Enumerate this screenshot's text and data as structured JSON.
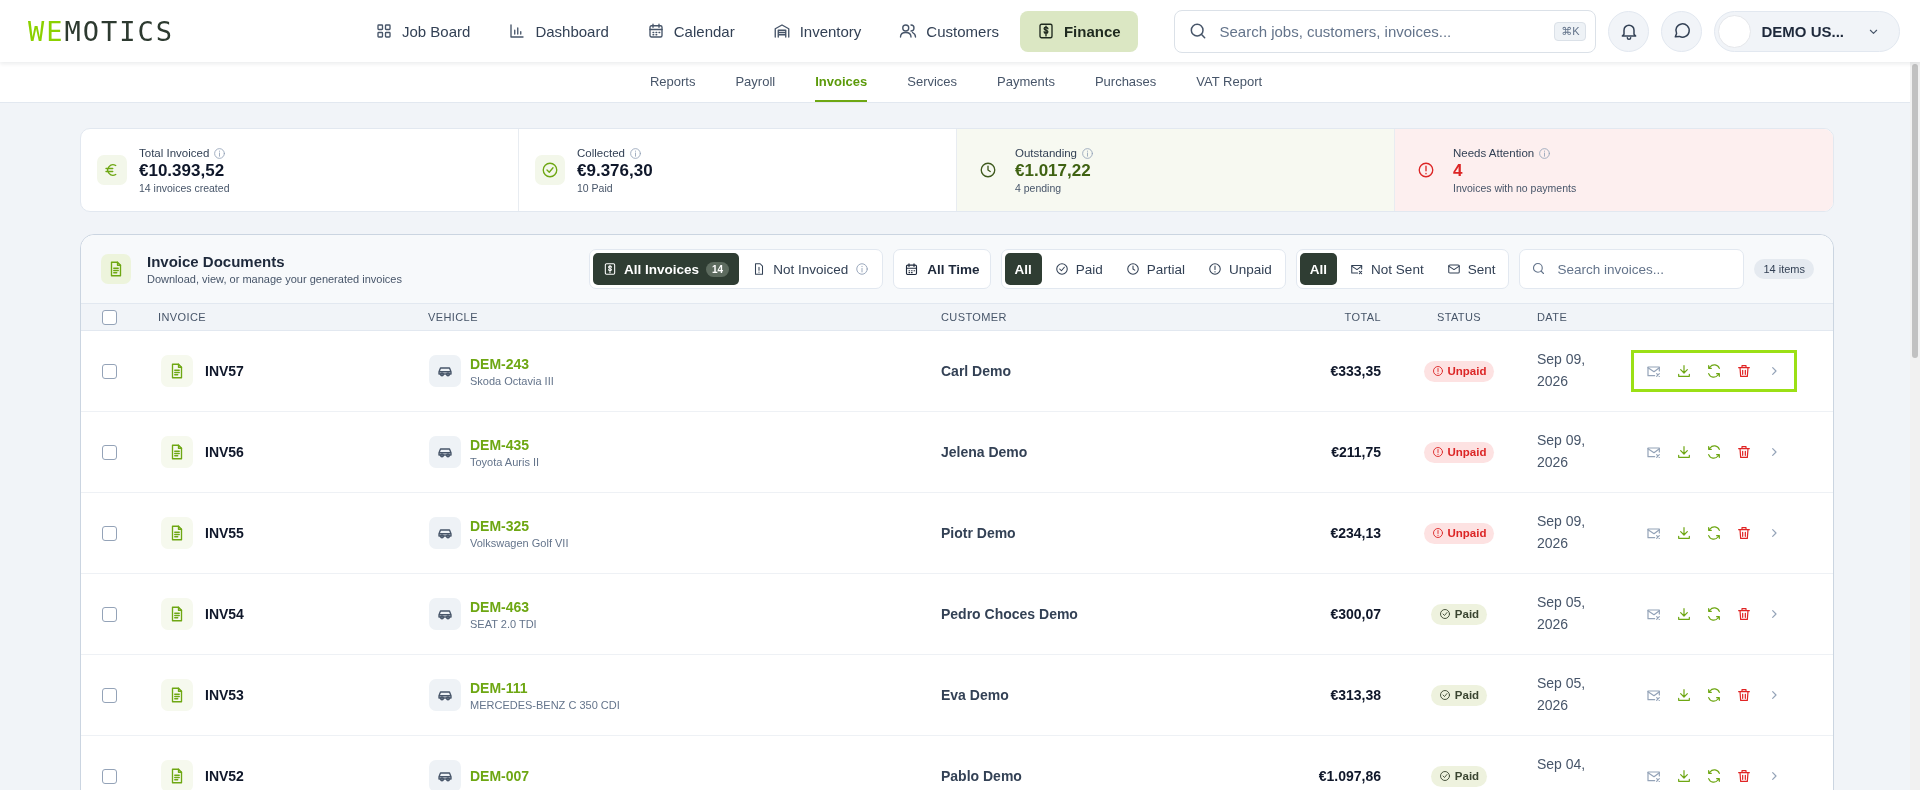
{
  "topbar": {
    "logo": {
      "accent": "WE",
      "rest": "MOTICS"
    },
    "nav": [
      {
        "label": "Job Board",
        "selected": false
      },
      {
        "label": "Dashboard",
        "selected": false
      },
      {
        "label": "Calendar",
        "selected": false
      },
      {
        "label": "Inventory",
        "selected": false
      },
      {
        "label": "Customers",
        "selected": false
      },
      {
        "label": "Finance",
        "selected": true
      }
    ],
    "search": {
      "placeholder": "Search jobs, customers, invoices...",
      "shortcut": "⌘K"
    },
    "user": {
      "name": "DEMO US..."
    }
  },
  "subnav": [
    {
      "label": "Reports",
      "selected": false
    },
    {
      "label": "Payroll",
      "selected": false
    },
    {
      "label": "Invoices",
      "selected": true
    },
    {
      "label": "Services",
      "selected": false
    },
    {
      "label": "Payments",
      "selected": false
    },
    {
      "label": "Purchases",
      "selected": false
    },
    {
      "label": "VAT Report",
      "selected": false
    }
  ],
  "summary": [
    {
      "kind": "total",
      "label": "Total Invoiced",
      "value": "€10.393,52",
      "note": "14 invoices created"
    },
    {
      "kind": "collected",
      "label": "Collected",
      "value": "€9.376,30",
      "note": "10 Paid"
    },
    {
      "kind": "outstanding",
      "label": "Outstanding",
      "value": "€1.017,22",
      "note": "4 pending"
    },
    {
      "kind": "attention",
      "label": "Needs Attention",
      "value": "4",
      "note": "Invoices with no payments"
    }
  ],
  "invoices": {
    "title": "Invoice Documents",
    "subtitle": "Download, view, or manage your generated invoices",
    "doc_tabs": [
      {
        "label": "All Invoices",
        "count": "14",
        "selected": true
      },
      {
        "label": "Not Invoiced",
        "selected": false
      }
    ],
    "period": "All Time",
    "payment_filter": [
      {
        "kind": "all",
        "label": "All",
        "selected": true
      },
      {
        "kind": "paid",
        "label": "Paid",
        "selected": false
      },
      {
        "kind": "partial",
        "label": "Partial",
        "selected": false
      },
      {
        "kind": "unpaid",
        "label": "Unpaid",
        "selected": false
      }
    ],
    "send_filter": [
      {
        "kind": "all",
        "label": "All",
        "selected": true
      },
      {
        "kind": "not_sent",
        "label": "Not Sent",
        "selected": false
      },
      {
        "kind": "sent",
        "label": "Sent",
        "selected": false
      }
    ],
    "search": {
      "placeholder": "Search invoices..."
    },
    "count": "14 items",
    "select_all": {
      "checked": false
    },
    "columns": [
      "INVOICE",
      "VEHICLE",
      "CUSTOMER",
      "TOTAL",
      "STATUS",
      "DATE"
    ],
    "rows": [
      {
        "checked": false,
        "highlighted": true,
        "number": "INV57",
        "plate": "DEM-243",
        "model": "Skoda Octavia III",
        "customer": "Carl Demo",
        "total": "€333,35",
        "status": {
          "kind": "unpaid",
          "label": "Unpaid"
        },
        "date": "Sep 09, 2026"
      },
      {
        "checked": false,
        "highlighted": false,
        "number": "INV56",
        "plate": "DEM-435",
        "model": "Toyota Auris II",
        "customer": "Jelena Demo",
        "total": "€211,75",
        "status": {
          "kind": "unpaid",
          "label": "Unpaid"
        },
        "date": "Sep 09, 2026"
      },
      {
        "checked": false,
        "highlighted": false,
        "number": "INV55",
        "plate": "DEM-325",
        "model": "Volkswagen Golf VII",
        "customer": "Piotr Demo",
        "total": "€234,13",
        "status": {
          "kind": "unpaid",
          "label": "Unpaid"
        },
        "date": "Sep 09, 2026"
      },
      {
        "checked": false,
        "highlighted": false,
        "number": "INV54",
        "plate": "DEM-463",
        "model": "SEAT 2.0 TDI",
        "customer": "Pedro Choces Demo",
        "total": "€300,07",
        "status": {
          "kind": "paid",
          "label": "Paid"
        },
        "date": "Sep 05, 2026"
      },
      {
        "checked": false,
        "highlighted": false,
        "number": "INV53",
        "plate": "DEM-111",
        "model": "MERCEDES-BENZ C 350 CDI",
        "customer": "Eva Demo",
        "total": "€313,38",
        "status": {
          "kind": "paid",
          "label": "Paid"
        },
        "date": "Sep 05, 2026"
      },
      {
        "checked": false,
        "highlighted": false,
        "number": "INV52",
        "plate": "DEM-007",
        "customer": "Pablo Demo",
        "total": "€1.097,86",
        "status": {
          "kind": "paid",
          "label": "Paid"
        },
        "date": "Sep 04,"
      }
    ]
  }
}
